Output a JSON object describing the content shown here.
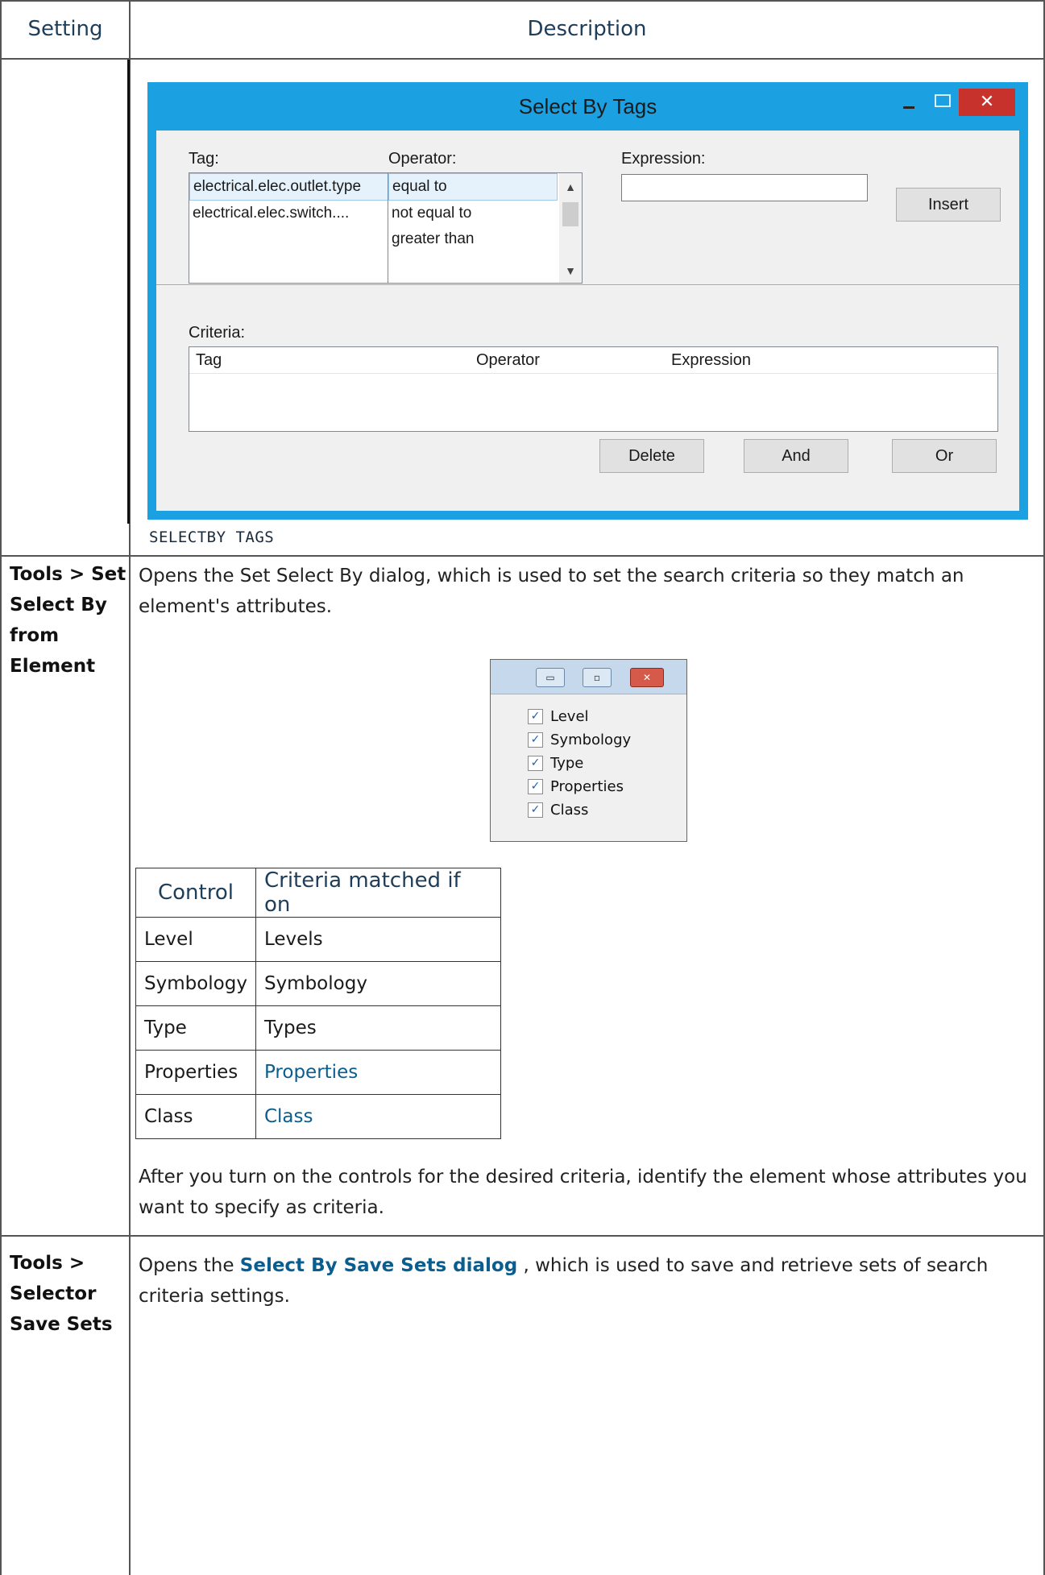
{
  "header": {
    "setting": "Setting",
    "description": "Description"
  },
  "tags_dialog": {
    "title": "Select By Tags",
    "tag_label": "Tag:",
    "tag_items": [
      "electrical.elec.outlet.type",
      "electrical.elec.switch...."
    ],
    "operator_label": "Operator:",
    "operator_items": [
      "equal to",
      "not equal to",
      "greater than"
    ],
    "expression_label": "Expression:",
    "expression_value": "",
    "insert_button": "Insert",
    "criteria_label": "Criteria:",
    "criteria_columns": [
      "Tag",
      "Operator",
      "Expression"
    ],
    "delete_button": "Delete",
    "and_button": "And",
    "or_button": "Or",
    "close_glyph": "✕"
  },
  "caption": "SELECTBY TAGS",
  "row_set_select_by": {
    "setting": "Tools > Set Select By from Element",
    "description": "Opens the Set Select By dialog, which is used to set the search criteria so they match an element's attributes.",
    "mini_dialog": {
      "items": [
        "Level",
        "Symbology",
        "Type",
        "Properties",
        "Class"
      ],
      "check_glyph": "✓",
      "close_glyph": "✕",
      "minimize_glyph": "▭",
      "restore_glyph": "▫"
    },
    "table": {
      "headers": [
        "Control",
        "Criteria matched if on"
      ],
      "rows": [
        {
          "control": "Level",
          "criteria": "Levels"
        },
        {
          "control": "Symbology",
          "criteria": "Symbology"
        },
        {
          "control": "Type",
          "criteria": "Types"
        },
        {
          "control": "Properties",
          "criteria": "Properties"
        },
        {
          "control": "Class",
          "criteria": "Class"
        }
      ]
    },
    "after_text": "After you turn on the controls for the desired criteria, identify the element whose attributes you want to specify as criteria."
  },
  "row_save_sets": {
    "setting": "Tools > Selector Save Sets",
    "description_prefix": "Opens the ",
    "description_link": "Select By Save Sets dialog",
    "description_suffix": " , which is used to save and retrieve sets of search criteria settings."
  },
  "colors": {
    "dialog_border": "#1ba1e2",
    "link": "#0a5d8f",
    "header_text": "#1e3d59",
    "close_button": "#c7332c"
  }
}
